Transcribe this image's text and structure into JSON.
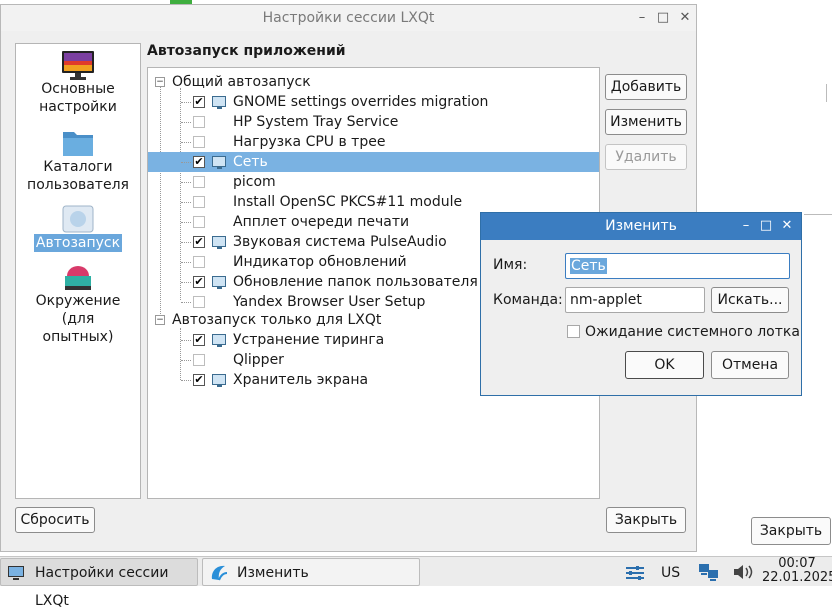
{
  "main_window": {
    "title": "Настройки сессии LXQt",
    "sidebar": [
      {
        "label_line1": "Основные",
        "label_line2": "настройки",
        "icon": "monitor-icon"
      },
      {
        "label_line1": "Каталоги",
        "label_line2": "пользователя",
        "icon": "folder-icon"
      },
      {
        "label_line1": "Автозапуск",
        "label_line2": "",
        "icon": "autostart-icon",
        "selected": true
      },
      {
        "label_line1": "Окружение (для",
        "label_line2": "опытных)",
        "icon": "environment-icon"
      }
    ],
    "heading": "Автозапуск приложений",
    "groups": [
      {
        "label": "Общий автозапуск",
        "expander": "−"
      },
      {
        "label": "Автозапуск только для LXQt",
        "expander": "−"
      }
    ],
    "items": [
      {
        "label": "GNOME settings overrides migration",
        "checked": "✔"
      },
      {
        "label": "HP System Tray Service",
        "checked": ""
      },
      {
        "label": "Нагрузка CPU в трее",
        "checked": ""
      },
      {
        "label": "Сеть",
        "checked": "✔",
        "selected": true
      },
      {
        "label": "picom",
        "checked": ""
      },
      {
        "label": "Install OpenSC PKCS#11 module",
        "checked": ""
      },
      {
        "label": "Апплет очереди печати",
        "checked": ""
      },
      {
        "label": "Звуковая система PulseAudio",
        "checked": "✔"
      },
      {
        "label": "Индикатор обновлений",
        "checked": ""
      },
      {
        "label": "Обновление папок пользователя",
        "checked": "✔"
      },
      {
        "label": "Yandex Browser User Setup",
        "checked": ""
      },
      {
        "label": "Устранение тиринга",
        "checked": "✔"
      },
      {
        "label": "Qlipper",
        "checked": ""
      },
      {
        "label": "Хранитель экрана",
        "checked": "✔"
      }
    ],
    "buttons": {
      "add": "Добавить",
      "edit": "Изменить",
      "delete": "Удалить",
      "reset": "Сбросить",
      "close": "Закрыть"
    }
  },
  "dialog": {
    "title": "Изменить",
    "name_label": "Имя:",
    "name_value": "Сеть",
    "command_label": "Команда:",
    "command_value": "nm-applet",
    "browse_button": "Искать...",
    "wait_tray_label": "Ожидание системного лотка",
    "ok_button": "OK",
    "cancel_button": "Отмена"
  },
  "background_window": {
    "close_button": "Закрыть"
  },
  "taskbar": {
    "tasks": [
      {
        "label": "Настройки сессии LXQt",
        "icon": "lxqt-settings-icon"
      },
      {
        "label": "Изменить",
        "icon": "lxqt-logo-icon"
      }
    ],
    "keyboard_layout": "US",
    "time": "00:07",
    "date": "22.01.2025"
  },
  "window_controls": {
    "minimize": "–",
    "maximize": "□",
    "close": "✕"
  },
  "colors": {
    "selection": "#7ab2e2",
    "dialog_title": "#3b7dc1",
    "accent": "#6aa7dc"
  }
}
